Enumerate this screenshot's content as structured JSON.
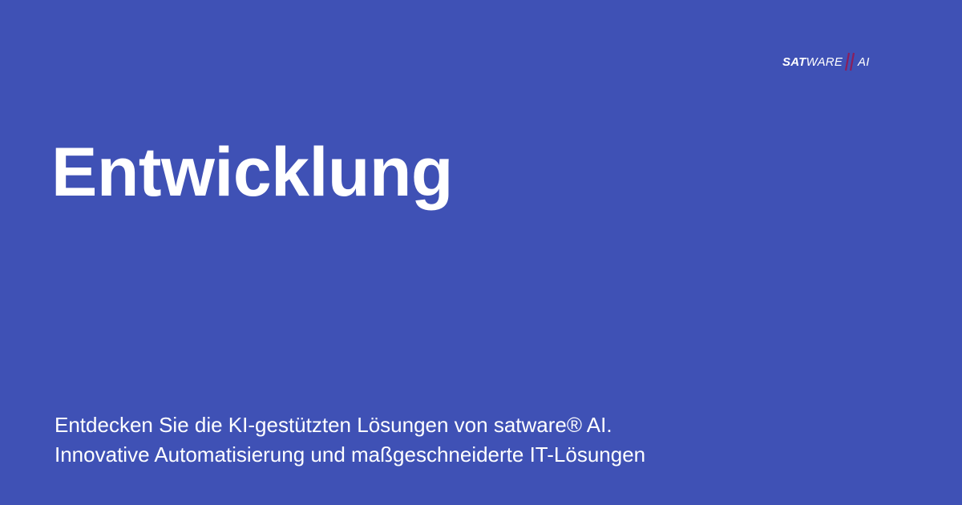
{
  "logo": {
    "part_bold": "SAT",
    "part_regular": "WARE",
    "part_ai": "AI",
    "slash_color": "#8a1f5c"
  },
  "headline": "Entwicklung",
  "description": {
    "line1": "Entdecken Sie die KI-gestützten Lösungen von satware® AI.",
    "line2": "Innovative Automatisierung und maßgeschneiderte IT-Lösungen"
  },
  "colors": {
    "background": "#3f51b5",
    "text": "#ffffff"
  }
}
